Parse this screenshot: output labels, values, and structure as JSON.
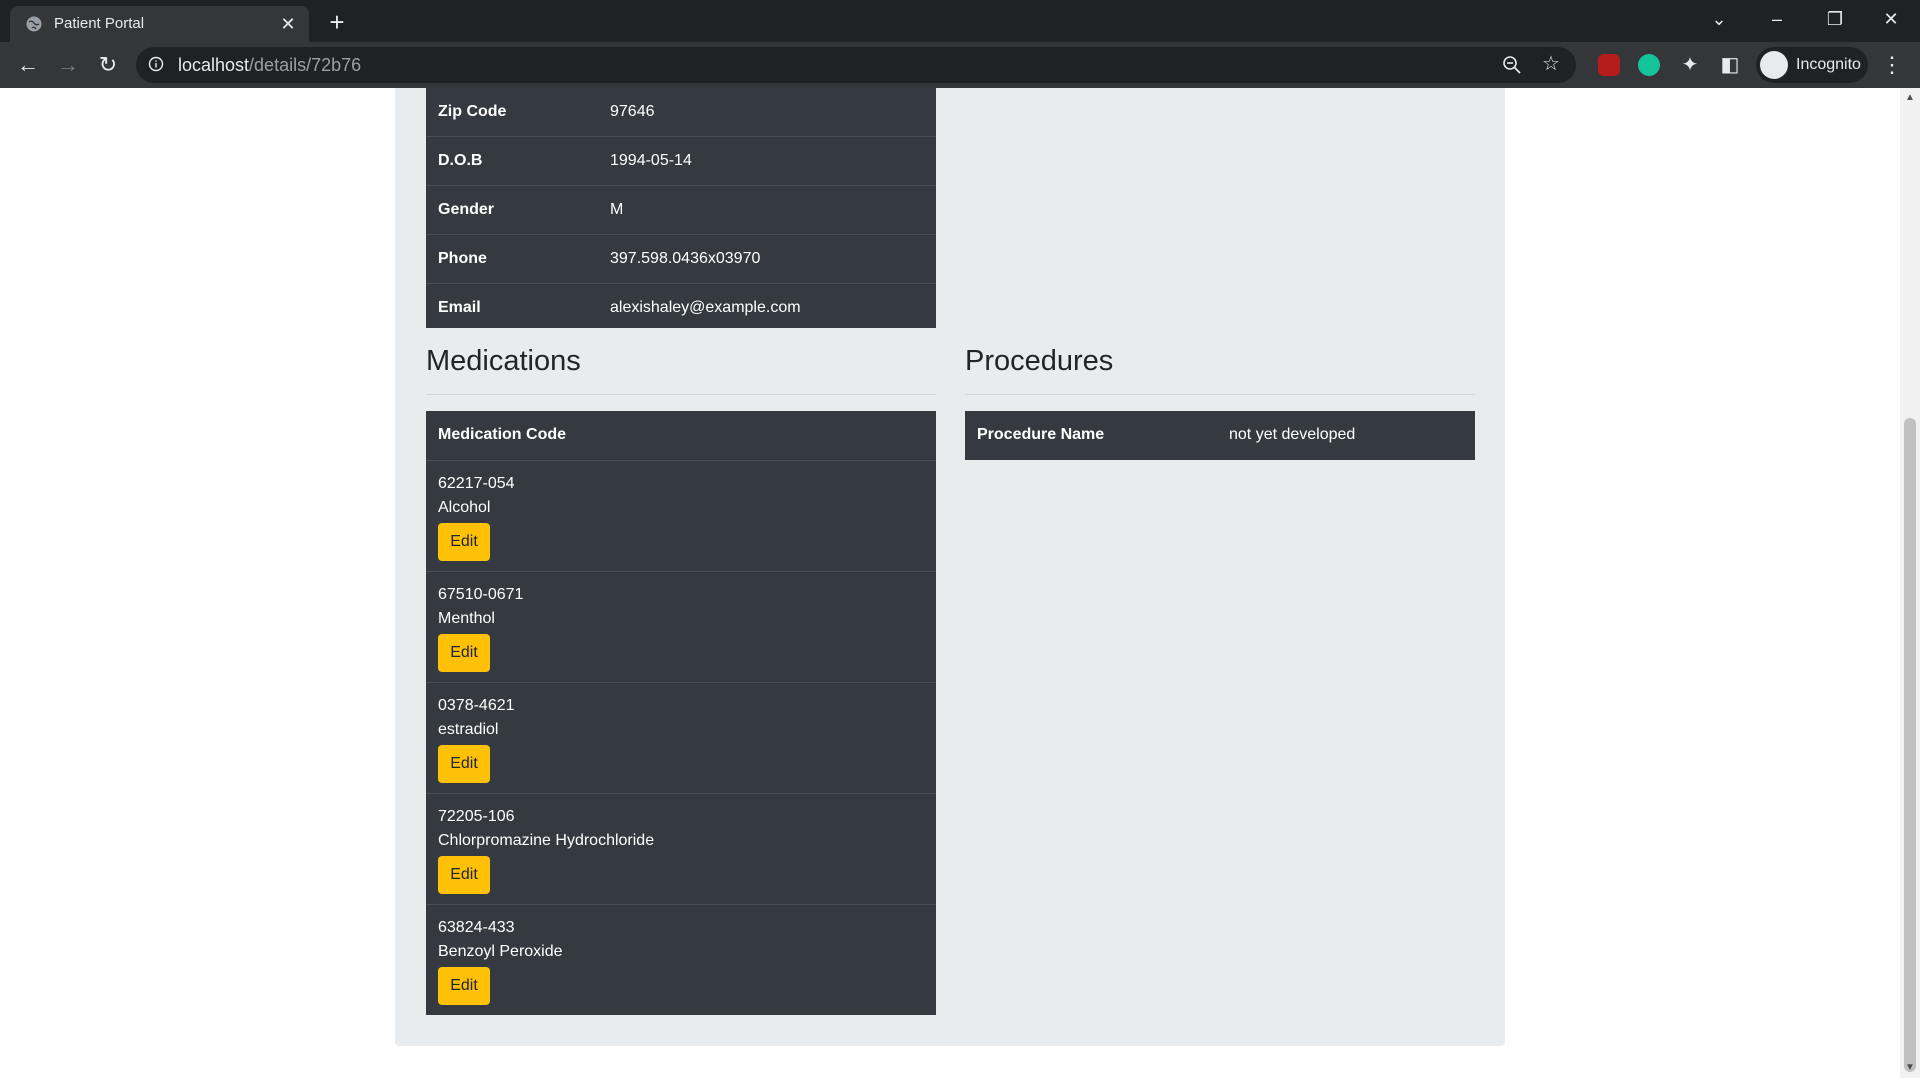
{
  "browser": {
    "tab_title": "Patient Portal",
    "url_host": "localhost",
    "url_path": "/details/72b76",
    "profile_label": "Incognito",
    "icons": [
      "globe-icon",
      "close-icon",
      "plus-icon",
      "chevron-down-icon",
      "minimize-icon",
      "restore-icon",
      "close-window-icon",
      "back-icon",
      "forward-icon",
      "reload-icon",
      "info-icon",
      "zoom-icon",
      "star-icon",
      "ublock-icon",
      "grammarly-icon",
      "puzzle-icon",
      "sidepanel-icon",
      "incognito-icon",
      "kebab-icon"
    ]
  },
  "patient_info": {
    "rows": [
      {
        "label": "Zip Code",
        "value": "97646"
      },
      {
        "label": "D.O.B",
        "value": "1994-05-14"
      },
      {
        "label": "Gender",
        "value": "M"
      },
      {
        "label": "Phone",
        "value": "397.598.0436x03970"
      },
      {
        "label": "Email",
        "value": "alexishaley@example.com"
      }
    ]
  },
  "medications": {
    "heading": "Medications",
    "column_header": "Medication Code",
    "edit_label": "Edit",
    "items": [
      {
        "code": "62217-054",
        "name": "Alcohol"
      },
      {
        "code": "67510-0671",
        "name": "Menthol"
      },
      {
        "code": "0378-4621",
        "name": "estradiol"
      },
      {
        "code": "72205-106",
        "name": "Chlorpromazine Hydrochloride"
      },
      {
        "code": "63824-433",
        "name": "Benzoyl Peroxide"
      }
    ]
  },
  "procedures": {
    "heading": "Procedures",
    "column_header": "Procedure Name",
    "value": "not yet developed"
  },
  "colors": {
    "table_bg": "#343a40",
    "container_bg": "#e9ecef",
    "edit_button": "#ffc107"
  }
}
